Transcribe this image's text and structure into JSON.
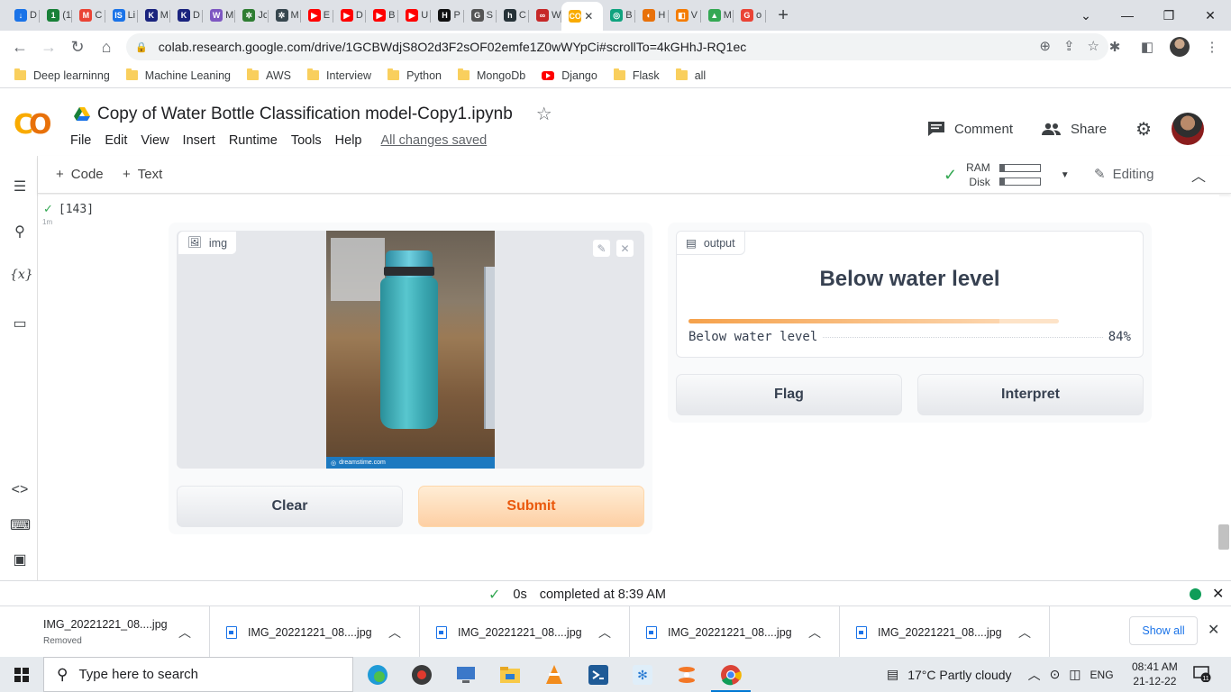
{
  "browser": {
    "tabs": [
      {
        "title": "D",
        "color": "#1a73e8",
        "glyph": "↓"
      },
      {
        "title": "(1",
        "color": "#188038",
        "glyph": "1"
      },
      {
        "title": "C",
        "color": "#ea4335",
        "glyph": "M"
      },
      {
        "title": "Li",
        "color": "#1a73e8",
        "glyph": "IS"
      },
      {
        "title": "M",
        "color": "#1a237e",
        "glyph": "K"
      },
      {
        "title": "D",
        "color": "#1a237e",
        "glyph": "K"
      },
      {
        "title": "M",
        "color": "#7e57c2",
        "glyph": "W"
      },
      {
        "title": "Jc",
        "color": "#2e7d32",
        "glyph": "✲"
      },
      {
        "title": "M",
        "color": "#37474f",
        "glyph": "✲"
      },
      {
        "title": "E",
        "color": "#ff0000",
        "glyph": "▶"
      },
      {
        "title": "D",
        "color": "#ff0000",
        "glyph": "▶"
      },
      {
        "title": "B",
        "color": "#ff0000",
        "glyph": "▶"
      },
      {
        "title": "U",
        "color": "#ff0000",
        "glyph": "▶"
      },
      {
        "title": "P",
        "color": "#111111",
        "glyph": "H"
      },
      {
        "title": "S",
        "color": "#555555",
        "glyph": "G"
      },
      {
        "title": "C",
        "color": "#263238",
        "glyph": "h"
      },
      {
        "title": "W",
        "color": "#c62828",
        "glyph": "∞"
      },
      {
        "title": "",
        "color": "#f9ab00",
        "glyph": "CO",
        "active": true
      },
      {
        "title": "B",
        "color": "#10a37f",
        "glyph": "◎"
      },
      {
        "title": "H",
        "color": "#e8710a",
        "glyph": "◐"
      },
      {
        "title": "V",
        "color": "#f57c00",
        "glyph": "◧"
      },
      {
        "title": "M",
        "color": "#34a853",
        "glyph": "▲"
      },
      {
        "title": "o",
        "color": "#ea4335",
        "glyph": "G"
      }
    ],
    "url": "colab.research.google.com/drive/1GCBWdjS8O2d3F2sOF02emfe1Z0wWYpCi#scrollTo=4kGHhJ-RQ1ec",
    "bookmarks": [
      {
        "label": "Deep learninng",
        "kind": "folder"
      },
      {
        "label": "Machine Leaning",
        "kind": "folder"
      },
      {
        "label": "AWS",
        "kind": "folder"
      },
      {
        "label": "Interview",
        "kind": "folder"
      },
      {
        "label": "Python",
        "kind": "folder"
      },
      {
        "label": "MongoDb",
        "kind": "folder"
      },
      {
        "label": "Django",
        "kind": "youtube"
      },
      {
        "label": "Flask",
        "kind": "folder"
      },
      {
        "label": "all",
        "kind": "folder"
      }
    ]
  },
  "colab": {
    "title": "Copy of Water Bottle Classification model-Copy1.ipynb",
    "menu": [
      "File",
      "Edit",
      "View",
      "Insert",
      "Runtime",
      "Tools",
      "Help"
    ],
    "saved_status": "All changes saved",
    "comment_label": "Comment",
    "share_label": "Share",
    "add_code_label": "Code",
    "add_text_label": "Text",
    "ram_label": "RAM",
    "disk_label": "Disk",
    "ram_usage": 0.12,
    "disk_usage": 0.12,
    "editing_label": "Editing"
  },
  "cell": {
    "exec_count": "[143]",
    "exec_time": "1m",
    "input_label": "img",
    "output_label": "output",
    "prediction_title": "Below water level",
    "confidence_class": "Below water level",
    "confidence_pct": "84%",
    "confidence_value": 0.84,
    "image_watermark": "dreamstime.com",
    "clear_button": "Clear",
    "submit_button": "Submit",
    "flag_button": "Flag",
    "interpret_button": "Interpret"
  },
  "statusbar": {
    "duration": "0s",
    "completed": "completed at 8:39 AM"
  },
  "downloads": {
    "items": [
      {
        "name": "IMG_20221221_08....jpg",
        "sub": "Removed"
      },
      {
        "name": "IMG_20221221_08....jpg",
        "sub": ""
      },
      {
        "name": "IMG_20221221_08....jpg",
        "sub": ""
      },
      {
        "name": "IMG_20221221_08....jpg",
        "sub": ""
      },
      {
        "name": "IMG_20221221_08....jpg",
        "sub": ""
      }
    ],
    "show_all": "Show all"
  },
  "taskbar": {
    "search_placeholder": "Type here to search",
    "weather": "17°C  Partly cloudy",
    "language": "ENG",
    "time": "08:41 AM",
    "date": "21-12-22",
    "notifications": "11"
  }
}
